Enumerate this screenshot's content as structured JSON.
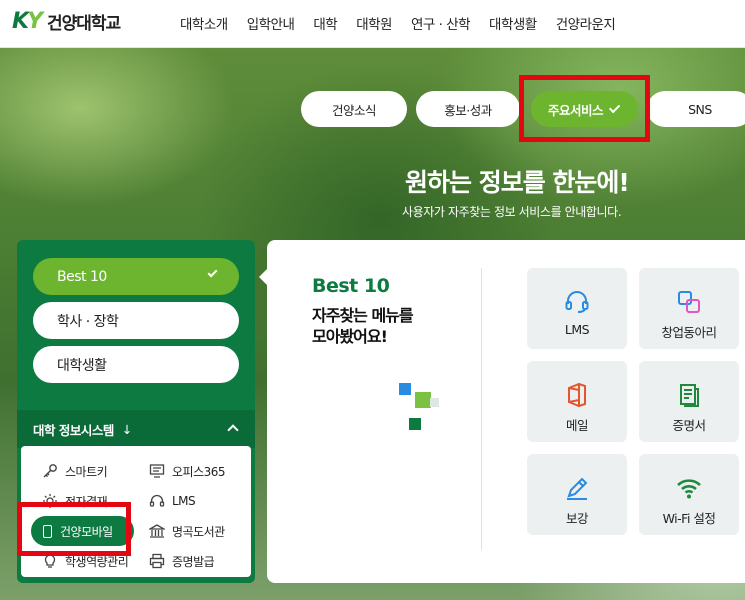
{
  "header": {
    "logo_mark_k": "K",
    "logo_mark_y": "Y",
    "logo_text": "건양대학교",
    "nav": [
      "대학소개",
      "입학안내",
      "대학",
      "대학원",
      "연구 · 산학",
      "대학생활",
      "건양라운지"
    ]
  },
  "categories": [
    {
      "label": "건양소식"
    },
    {
      "label": "홍보·성과"
    },
    {
      "label": "주요서비스"
    },
    {
      "label": "SNS"
    }
  ],
  "hero": {
    "title": "원하는 정보를 한눈에!",
    "subtitle": "사용자가 자주찾는 정보 서비스를 안내합니다."
  },
  "left_menu": {
    "items": [
      {
        "label": "Best 10"
      },
      {
        "label": "학사 · 장학"
      },
      {
        "label": "대학생활"
      }
    ],
    "system_title": "대학 정보시스템",
    "system_arrow": "↓",
    "systems": [
      {
        "label": "스마트키",
        "icon": "key-icon"
      },
      {
        "label": "오피스365",
        "icon": "monitor-icon"
      },
      {
        "label": "전자결재",
        "icon": "sun-icon"
      },
      {
        "label": "LMS",
        "icon": "headset-icon"
      },
      {
        "label": "건양모바일",
        "icon": "phone-icon"
      },
      {
        "label": "명곡도서관",
        "icon": "library-icon"
      },
      {
        "label": "학생역량관리",
        "icon": "bulb-icon"
      },
      {
        "label": "증명발급",
        "icon": "printer-icon"
      }
    ]
  },
  "best10": {
    "title": "Best 10",
    "desc_line1": "자주찾는 메뉴를",
    "desc_line2": "모아봤어요!",
    "tiles": [
      {
        "label": "LMS",
        "icon": "headset-icon"
      },
      {
        "label": "창업동아리",
        "icon": "squares-icon"
      },
      {
        "label": "메일",
        "icon": "office-icon"
      },
      {
        "label": "증명서",
        "icon": "document-icon"
      },
      {
        "label": "보강",
        "icon": "pencil-icon"
      },
      {
        "label": "Wi-Fi 설정",
        "icon": "wifi-icon"
      }
    ]
  },
  "colors": {
    "brand_green": "#0c7a41",
    "accent_green": "#6db52e",
    "highlight_red": "#e30613"
  }
}
